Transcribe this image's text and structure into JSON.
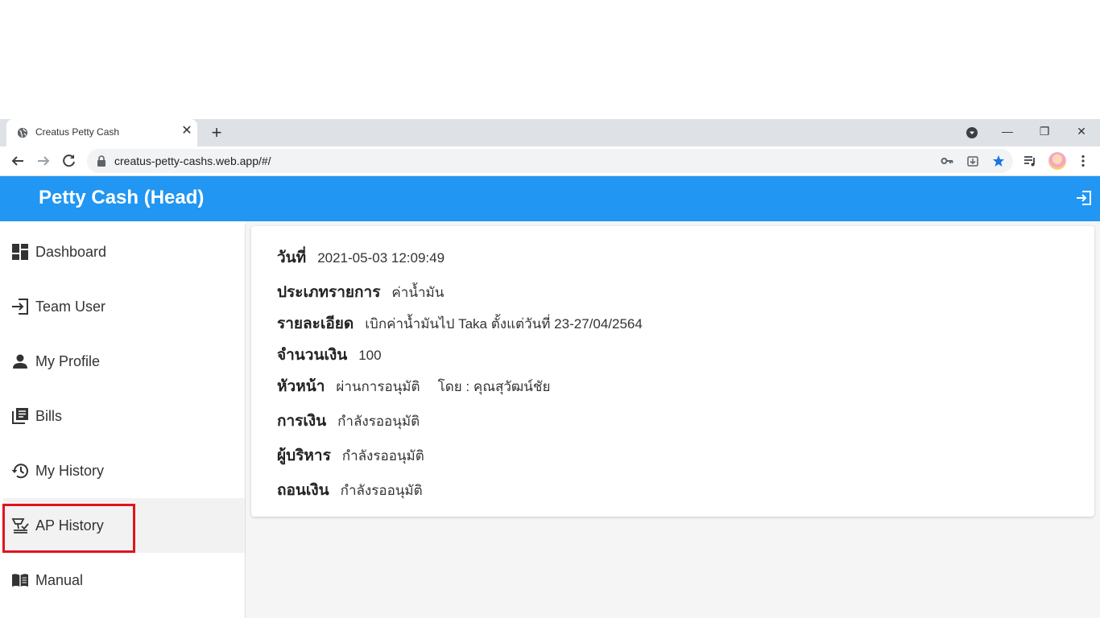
{
  "browser": {
    "tab_title": "Creatus Petty Cash",
    "url": "creatus-petty-cashs.web.app/#/"
  },
  "app": {
    "title": "Petty Cash (Head)",
    "accent_color": "#2196f3"
  },
  "sidebar": {
    "items": [
      {
        "label": "Dashboard",
        "icon": "dashboard-icon"
      },
      {
        "label": "Team User",
        "icon": "login-icon"
      },
      {
        "label": "My Profile",
        "icon": "person-icon"
      },
      {
        "label": "Bills",
        "icon": "library-books-icon"
      },
      {
        "label": "My History",
        "icon": "history-icon"
      },
      {
        "label": "AP History",
        "icon": "approval-icon",
        "active": true
      },
      {
        "label": "Manual",
        "icon": "menu-book-icon"
      }
    ]
  },
  "detail": {
    "date_label": "วันที่",
    "date_value": "2021-05-03  12:09:49",
    "type_label": "ประเภทรายการ",
    "type_value": "ค่าน้ำมัน",
    "desc_label": "รายละเอียด",
    "desc_value": "เบิกค่าน้ำมันไป Taka ตั้งแต่วันที่ 23-27/04/2564",
    "amount_label": "จำนวนเงิน",
    "amount_value": "100",
    "head_label": "หัวหน้า",
    "head_value": "ผ่านการอนุมัติ",
    "head_by": "โดย : คุณสุวัฒน์ชัย",
    "finance_label": "การเงิน",
    "finance_value": "กำลังรออนุมัติ",
    "exec_label": "ผู้บริหาร",
    "exec_value": "กำลังรออนุมัติ",
    "withdraw_label": "ถอนเงิน",
    "withdraw_value": "กำลังรออนุมัติ"
  }
}
